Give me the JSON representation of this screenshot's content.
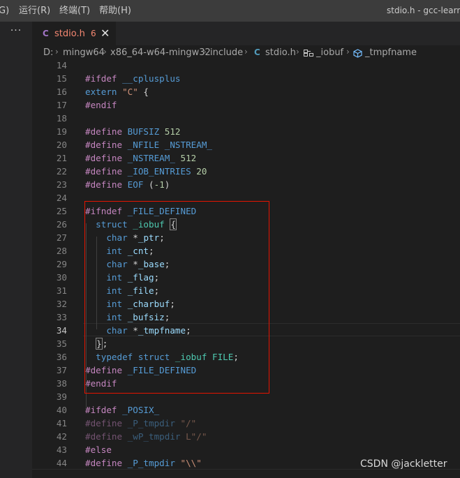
{
  "menubar": {
    "partial_item": "G)",
    "run": "运行(R)",
    "terminal": "终端(T)",
    "help": "帮助(H)"
  },
  "window_title": "stdio.h - gcc-learn -",
  "activitybar": {
    "more": "···"
  },
  "tab": {
    "lang_icon": "C",
    "filename": "stdio.h",
    "problem_count": "6",
    "close": "✕"
  },
  "breadcrumb": [
    "D:",
    "mingw64",
    "x86_64-w64-mingw32",
    "include",
    "stdio.h",
    "_iobuf",
    "_tmpfname"
  ],
  "code": {
    "active_line": 34,
    "lines": [
      {
        "n": "14",
        "tokens": []
      },
      {
        "n": "15",
        "tokens": [
          [
            "pp",
            "#ifdef "
          ],
          [
            "mac",
            "__cplusplus"
          ]
        ]
      },
      {
        "n": "16",
        "tokens": [
          [
            "kw",
            "extern "
          ],
          [
            "str",
            "\"C\""
          ],
          [
            "tx",
            " {"
          ]
        ]
      },
      {
        "n": "17",
        "tokens": [
          [
            "pp",
            "#endif"
          ]
        ]
      },
      {
        "n": "18",
        "tokens": []
      },
      {
        "n": "19",
        "tokens": [
          [
            "pp",
            "#define "
          ],
          [
            "mac",
            "BUFSIZ "
          ],
          [
            "num",
            "512"
          ]
        ]
      },
      {
        "n": "20",
        "tokens": [
          [
            "pp",
            "#define "
          ],
          [
            "mac",
            "_NFILE _NSTREAM_"
          ]
        ]
      },
      {
        "n": "21",
        "tokens": [
          [
            "pp",
            "#define "
          ],
          [
            "mac",
            "_NSTREAM_ "
          ],
          [
            "num",
            "512"
          ]
        ]
      },
      {
        "n": "22",
        "tokens": [
          [
            "pp",
            "#define "
          ],
          [
            "mac",
            "_IOB_ENTRIES "
          ],
          [
            "num",
            "20"
          ]
        ]
      },
      {
        "n": "23",
        "tokens": [
          [
            "pp",
            "#define "
          ],
          [
            "mac",
            "EOF "
          ],
          [
            "tx",
            "("
          ],
          [
            "num",
            "-1"
          ],
          [
            "tx",
            ")"
          ]
        ]
      },
      {
        "n": "24",
        "tokens": []
      },
      {
        "n": "25",
        "tokens": [
          [
            "pp",
            "#ifndef "
          ],
          [
            "mac",
            "_FILE_DEFINED"
          ]
        ]
      },
      {
        "n": "26",
        "tokens": [
          [
            "tx",
            "  "
          ],
          [
            "kw",
            "struct "
          ],
          [
            "ty",
            "_iobuf "
          ],
          [
            "brk",
            "{"
          ]
        ]
      },
      {
        "n": "27",
        "tokens": [
          [
            "tx",
            "    "
          ],
          [
            "kw",
            "char "
          ],
          [
            "tx",
            "*"
          ],
          [
            "id",
            "_ptr"
          ],
          [
            "tx",
            ";"
          ]
        ]
      },
      {
        "n": "28",
        "tokens": [
          [
            "tx",
            "    "
          ],
          [
            "kw",
            "int "
          ],
          [
            "id",
            "_cnt"
          ],
          [
            "tx",
            ";"
          ]
        ]
      },
      {
        "n": "29",
        "tokens": [
          [
            "tx",
            "    "
          ],
          [
            "kw",
            "char "
          ],
          [
            "tx",
            "*"
          ],
          [
            "id",
            "_base"
          ],
          [
            "tx",
            ";"
          ]
        ]
      },
      {
        "n": "30",
        "tokens": [
          [
            "tx",
            "    "
          ],
          [
            "kw",
            "int "
          ],
          [
            "id",
            "_flag"
          ],
          [
            "tx",
            ";"
          ]
        ]
      },
      {
        "n": "31",
        "tokens": [
          [
            "tx",
            "    "
          ],
          [
            "kw",
            "int "
          ],
          [
            "id",
            "_file"
          ],
          [
            "tx",
            ";"
          ]
        ]
      },
      {
        "n": "32",
        "tokens": [
          [
            "tx",
            "    "
          ],
          [
            "kw",
            "int "
          ],
          [
            "id",
            "_charbuf"
          ],
          [
            "tx",
            ";"
          ]
        ]
      },
      {
        "n": "33",
        "tokens": [
          [
            "tx",
            "    "
          ],
          [
            "kw",
            "int "
          ],
          [
            "id",
            "_bufsiz"
          ],
          [
            "tx",
            ";"
          ]
        ]
      },
      {
        "n": "34",
        "tokens": [
          [
            "tx",
            "    "
          ],
          [
            "kw",
            "char "
          ],
          [
            "tx",
            "*"
          ],
          [
            "id",
            "_tmpfname"
          ],
          [
            "tx",
            ";"
          ]
        ]
      },
      {
        "n": "35",
        "tokens": [
          [
            "tx",
            "  "
          ],
          [
            "brk",
            "}"
          ],
          [
            "tx",
            ";"
          ]
        ]
      },
      {
        "n": "36",
        "tokens": [
          [
            "tx",
            "  "
          ],
          [
            "kw",
            "typedef "
          ],
          [
            "kw",
            "struct "
          ],
          [
            "ty",
            "_iobuf "
          ],
          [
            "ty",
            "FILE"
          ],
          [
            "tx",
            ";"
          ]
        ]
      },
      {
        "n": "37",
        "tokens": [
          [
            "pp",
            "#define "
          ],
          [
            "mac",
            "_FILE_DEFINED"
          ]
        ]
      },
      {
        "n": "38",
        "tokens": [
          [
            "pp",
            "#endif"
          ]
        ]
      },
      {
        "n": "39",
        "tokens": []
      },
      {
        "n": "40",
        "tokens": [
          [
            "pp",
            "#ifdef "
          ],
          [
            "mac",
            "_POSIX_"
          ]
        ]
      },
      {
        "n": "41",
        "tokens": [
          [
            "pp dim",
            "#define "
          ],
          [
            "mac dim",
            "_P_tmpdir "
          ],
          [
            "str dim",
            "\"/\""
          ]
        ]
      },
      {
        "n": "42",
        "tokens": [
          [
            "pp dim",
            "#define "
          ],
          [
            "mac dim",
            "_wP_tmpdir "
          ],
          [
            "str dim",
            "L\"/\""
          ]
        ]
      },
      {
        "n": "43",
        "tokens": [
          [
            "pp",
            "#else"
          ]
        ]
      },
      {
        "n": "44",
        "tokens": [
          [
            "pp",
            "#define "
          ],
          [
            "mac",
            "_P_tmpdir "
          ],
          [
            "str",
            "\"\\\\\""
          ]
        ]
      }
    ]
  },
  "watermark": "CSDN @jackletter"
}
